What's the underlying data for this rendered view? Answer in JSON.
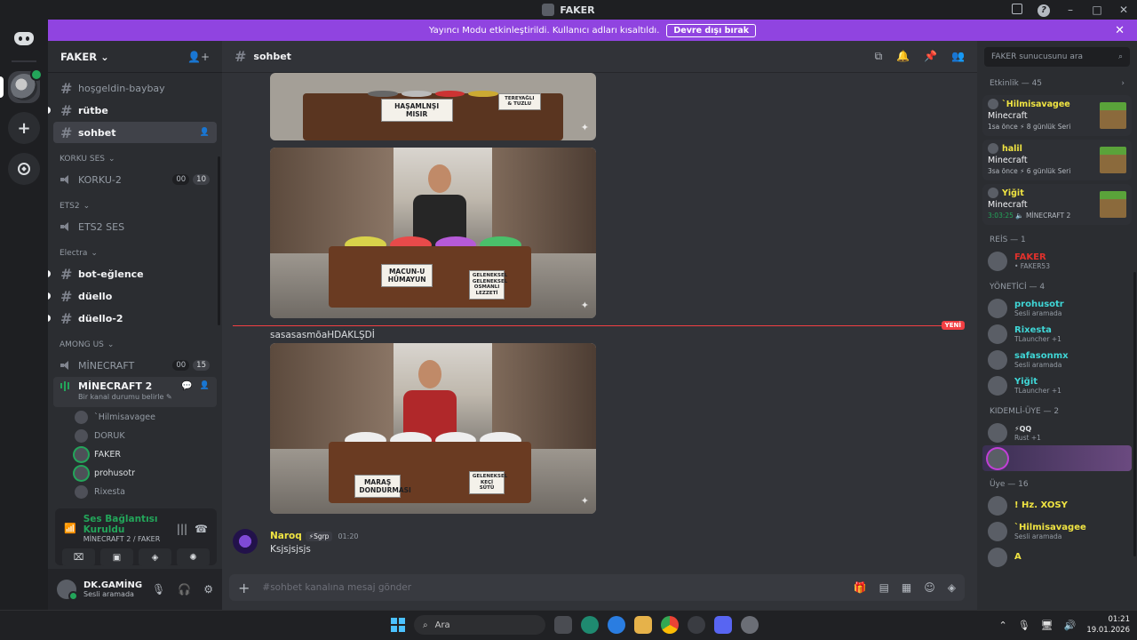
{
  "window": {
    "title": "FAKER"
  },
  "banner": {
    "text": "Yayıncı Modu etkinleştirildi. Kullanıcı adları kısaltıldı.",
    "button": "Devre dışı bırak"
  },
  "server": {
    "name": "FAKER"
  },
  "channels": {
    "top": [
      {
        "name": "hoşgeldin-baybay",
        "state": "muted"
      },
      {
        "name": "rütbe",
        "state": "unread"
      },
      {
        "name": "sohbet",
        "state": "active"
      }
    ],
    "cat_korku": "KORKU SES",
    "korku2": {
      "name": "KORKU-2",
      "c1": "00",
      "c2": "10"
    },
    "cat_ets2": "ETS2",
    "ets2": {
      "name": "ETS2 SES"
    },
    "cat_electra": "Electra",
    "electra": [
      "bot-eğlence",
      "düello",
      "düello-2"
    ],
    "cat_among": "AMONG US",
    "minecraft": {
      "name": "MİNECRAFT",
      "c1": "00",
      "c2": "15"
    },
    "minecraft2": {
      "name": "MİNECRAFT 2",
      "sub": "Bir kanal durumu belirle"
    },
    "voice_users": [
      "`Hilmisavagee",
      "DORUK",
      "FAKER",
      "prohusotr",
      "Rixesta"
    ]
  },
  "voice_panel": {
    "status": "Ses Bağlantısı Kuruldu",
    "channel": "MİNECRAFT 2 / FAKER"
  },
  "user_panel": {
    "name": "DK.GAMİNG",
    "status": "Sesli aramada"
  },
  "chat": {
    "channel": "sohbet",
    "images": {
      "img1_sign1": "HAŞAMLNŞI MISIR",
      "img1_sign2": "TEREYAĞLI & TUZLU",
      "img2_sign1": "MACUN-U HÜMAYUN",
      "img2_sign2": "GELENEKSEL GELENEKSEL OSMANLI LEZZETİ",
      "img3_sign1": "MARAŞ DONDURMASI",
      "img3_sign2": "GELENEKSEL KEÇİ SÜTÜ"
    },
    "new_label": "YENİ",
    "caption": "sasasasmõaHDAKLŞDİ",
    "message": {
      "author": "Naroq",
      "tag": "Sgrp",
      "time": "01:20",
      "text": "Ksjsjsjsjs"
    },
    "composer_placeholder": "#sohbet kanalına mesaj gönder"
  },
  "members": {
    "search_placeholder": "FAKER sunucusunu ara",
    "activity_header": "Etkinlik — 45",
    "activities": [
      {
        "user": "`Hilmisavagee",
        "game": "Minecraft",
        "detail1": "1sa önce",
        "detail2": "8 günlük Seri",
        "color": "#f0e442"
      },
      {
        "user": "halil",
        "game": "Minecraft",
        "detail1": "3sa önce",
        "detail2": "6 günlük Seri",
        "color": "#f0e442"
      },
      {
        "user": "Yiğit",
        "game": "Minecraft",
        "detail1": "3:03:25",
        "detail2": "MİNECRAFT 2",
        "color": "#f0e442"
      }
    ],
    "groups": [
      {
        "header": "REİS — 1",
        "members": [
          {
            "name": "FAKER",
            "status": "• FAKER53",
            "color": "#e0312c"
          }
        ]
      },
      {
        "header": "YÖNETİCİ — 4",
        "members": [
          {
            "name": "prohusotr",
            "status": "Sesli aramada",
            "color": "#3fd6d6"
          },
          {
            "name": "Rixesta",
            "status": "TLauncher +1",
            "color": "#3fd6d6"
          },
          {
            "name": "safasonmx",
            "status": "Sesli aramada",
            "color": "#3fd6d6"
          },
          {
            "name": "Yiğit",
            "status": "TLauncher +1",
            "color": "#3fd6d6"
          }
        ]
      },
      {
        "header": "KIDEMLİ-ÜYE — 2",
        "members": [
          {
            "name": "",
            "tag": "QQ",
            "status": "Rust +1",
            "color": "#4a6cf7"
          },
          {
            "name": "",
            "status": "",
            "color": "#4a6cf7"
          }
        ]
      },
      {
        "header": "Üye — 16",
        "members": [
          {
            "name": "! Hz. XOSY",
            "status": "",
            "color": "#f0e442"
          },
          {
            "name": "`Hilmisavagee",
            "status": "Sesli aramada",
            "color": "#f0e442"
          },
          {
            "name": "A",
            "status": "",
            "color": "#f0e442"
          }
        ]
      }
    ]
  },
  "taskbar": {
    "search": "Ara",
    "time": "01:21",
    "date": "19.01.2026"
  }
}
